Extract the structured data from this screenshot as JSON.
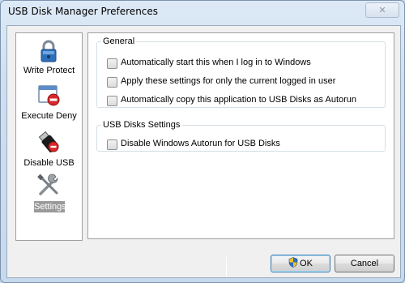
{
  "window": {
    "title": "USB Disk Manager Preferences",
    "close_glyph": "✕"
  },
  "sidebar": {
    "items": [
      {
        "label": "Write Protect",
        "icon": "padlock-icon"
      },
      {
        "label": "Execute Deny",
        "icon": "deny-window-icon"
      },
      {
        "label": "Disable USB",
        "icon": "usb-drive-icon"
      },
      {
        "label": "Settings",
        "icon": "tools-icon",
        "selected": true
      }
    ]
  },
  "general": {
    "title": "General",
    "options": [
      {
        "label": "Automatically start this when I log in to Windows",
        "checked": false
      },
      {
        "label": "Apply these settings for only the current logged in user",
        "checked": false
      },
      {
        "label": "Automatically copy this application to USB Disks as Autorun",
        "checked": false
      }
    ]
  },
  "usb_settings": {
    "title": "USB Disks Settings",
    "options": [
      {
        "label": "Disable Windows Autorun for USB Disks",
        "checked": false
      }
    ]
  },
  "buttons": {
    "ok": "OK",
    "cancel": "Cancel"
  },
  "colors": {
    "title_bar": "#cfdff0",
    "selected_item": "#9a9a9a",
    "panel": "#f0f0f0"
  }
}
